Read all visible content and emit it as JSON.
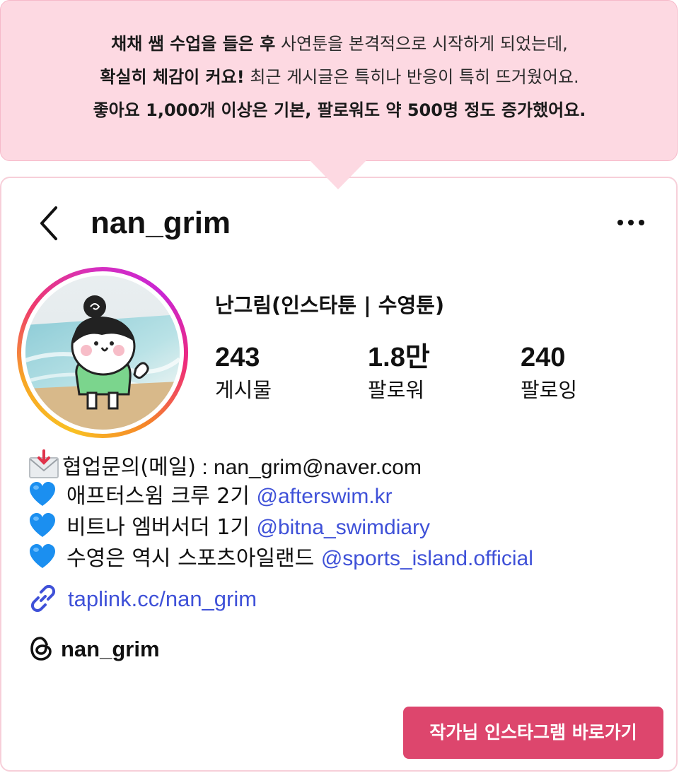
{
  "bubble": {
    "line1_bold": "채채 쌤 수업을 들은 후",
    "line1_rest": " 사연툰을 본격적으로 시작하게 되었는데,",
    "line2_bold": "확실히 체감이 커요!",
    "line2_rest": " 최근 게시글은 특히나 반응이 특히 뜨거웠어요.",
    "line3_bold": "좋아요 1,000개 이상은 기본, 팔로워도 약 500명 정도 증가했어요."
  },
  "profile": {
    "username": "nan_grim",
    "display_name": "난그림(인스타툰 | 수영툰)",
    "stats": [
      {
        "value": "243",
        "label": "게시물"
      },
      {
        "value": "1.8만",
        "label": "팔로워"
      },
      {
        "value": "240",
        "label": "팔로잉"
      }
    ]
  },
  "bio": {
    "contact_label": "협업문의(메일)",
    "contact_rest": " : nan_grim@naver.com",
    "lines": [
      {
        "text": "애프터스윔 크루 2기 ",
        "mention": "@afterswim.kr"
      },
      {
        "text": "비트나 엠버서더 1기 ",
        "mention": "@bitna_swimdiary"
      },
      {
        "text": "수영은 역시 스포츠아일랜드 ",
        "mention": "@sports_island.official"
      }
    ],
    "link": "taplink.cc/nan_grim",
    "threads": "nan_grim"
  },
  "cta": {
    "label": "작가님 인스타그램 바로가기"
  },
  "colors": {
    "bubble_bg": "#fdd9e2",
    "mention": "#3f51d8",
    "cta_bg": "#dd466d",
    "heart": "#1b8ff0"
  },
  "icons": [
    "back-chevron-icon",
    "more-icon",
    "envelope-icon",
    "blue-heart-icon",
    "link-icon",
    "threads-icon"
  ]
}
